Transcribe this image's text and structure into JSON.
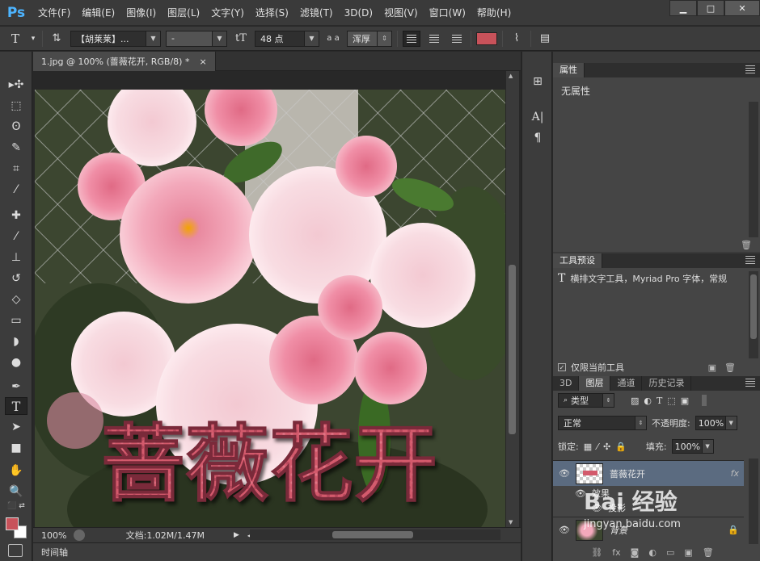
{
  "app": {
    "logo": "Ps"
  },
  "menu": [
    "文件(F)",
    "编辑(E)",
    "图像(I)",
    "图层(L)",
    "文字(Y)",
    "选择(S)",
    "滤镜(T)",
    "3D(D)",
    "视图(V)",
    "窗口(W)",
    "帮助(H)"
  ],
  "options": {
    "font_family": "【胡莱莱】...",
    "font_style": "-",
    "font_size": "48 点",
    "antialias_label": "a a",
    "antialias": "浑厚",
    "text_color": "#c8525a"
  },
  "document": {
    "tab_title": "1.jpg @ 100% (蔷薇花开, RGB/8) *",
    "close": "×",
    "canvas_text": "蔷薇花开",
    "zoom": "100%",
    "doc_info": "文档:1.02M/1.47M"
  },
  "timeline": {
    "label": "时间轴"
  },
  "properties": {
    "tab": "属性",
    "empty_text": "无属性"
  },
  "tool_presets": {
    "tab": "工具预设",
    "item": "横排文字工具，Myriad Pro 字体，常规",
    "current_only": "仅限当前工具"
  },
  "layers_panel": {
    "tabs": [
      "3D",
      "图层",
      "通道",
      "历史记录"
    ],
    "active_tab": "图层",
    "filter_kind": "类型",
    "blend_mode": "正常",
    "opacity_label": "不透明度:",
    "opacity": "100%",
    "lock_label": "锁定:",
    "fill_label": "填充:",
    "fill": "100%",
    "layers": [
      {
        "name": "蔷薇花开",
        "fx": "fx",
        "effects_label": "效果",
        "effect": "投影"
      },
      {
        "name": "背景"
      }
    ]
  },
  "watermark": {
    "brand": "Bai 经验",
    "url": "jingyan.baidu.com"
  },
  "colors": {
    "foreground": "#c8525a",
    "background": "#ffffff",
    "accent": "#4db4ff"
  }
}
